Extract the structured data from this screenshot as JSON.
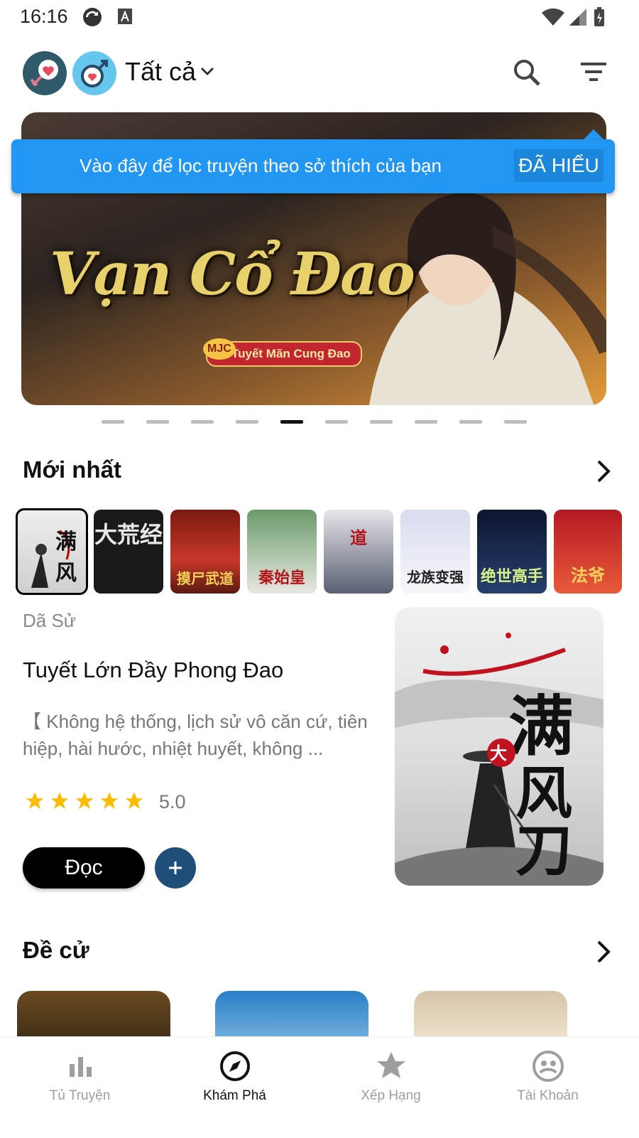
{
  "status_bar": {
    "time": "16:16"
  },
  "header": {
    "filter_label": "Tất cả",
    "icons": [
      "gender-love-icon",
      "male-love-icon",
      "chevron-down-icon",
      "search-icon",
      "filter-icon"
    ]
  },
  "tooltip": {
    "text": "Vào đây để lọc truyện theo sở thích của bạn",
    "button": "ĐÃ HIỂU"
  },
  "banner": {
    "title": "Vạn Cổ Đao",
    "tag": "Tuyết Mãn Cung Đao",
    "logo": "MJC",
    "page_count": 10,
    "active_index": 4
  },
  "latest": {
    "title": "Mới nhất",
    "book_covers": [
      "满风刀",
      "大荒经",
      "摸尸武道",
      "秦始皇",
      "道",
      "龙族变强",
      "绝世高手",
      "法爷"
    ],
    "selected_index": 0,
    "featured": {
      "genre": "Dã Sử",
      "title": "Tuyết Lớn Đầy Phong Đao",
      "description": "【 Không hệ thống, lịch sử vô căn cứ, tiên hiệp, hài hước, nhiệt huyết, không ...",
      "rating": "5.0",
      "stars": 5,
      "read_label": "Đọc",
      "add_label": "+"
    }
  },
  "recommended": {
    "title": "Đề cử"
  },
  "bottom_nav": {
    "items": [
      {
        "label": "Tủ Truyện",
        "icon": "bar-chart-icon"
      },
      {
        "label": "Khám Phá",
        "icon": "compass-icon"
      },
      {
        "label": "Xếp Hạng",
        "icon": "star-icon"
      },
      {
        "label": "Tài Khoản",
        "icon": "account-icon"
      }
    ],
    "active_index": 1
  },
  "colors": {
    "accent": "#2196f3",
    "star": "#fbbc05",
    "primary_button": "#000000",
    "add_button": "#1f4f79"
  }
}
